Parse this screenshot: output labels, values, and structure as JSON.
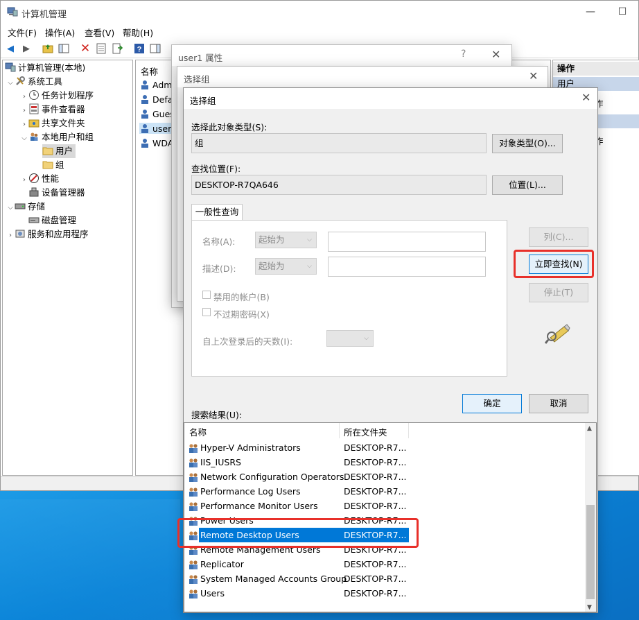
{
  "window": {
    "title": "计算机管理"
  },
  "menu": [
    "文件(F)",
    "操作(A)",
    "查看(V)",
    "帮助(H)"
  ],
  "tree": {
    "root": "计算机管理(本地)",
    "items": [
      {
        "label": "系统工具",
        "level": 1,
        "expanded": true
      },
      {
        "label": "任务计划程序",
        "level": 2,
        "expanded": false
      },
      {
        "label": "事件查看器",
        "level": 2,
        "expanded": false
      },
      {
        "label": "共享文件夹",
        "level": 2,
        "expanded": false
      },
      {
        "label": "本地用户和组",
        "level": 2,
        "expanded": true
      },
      {
        "label": "用户",
        "level": 3,
        "selected": true
      },
      {
        "label": "组",
        "level": 3
      },
      {
        "label": "性能",
        "level": 2,
        "expanded": false
      },
      {
        "label": "设备管理器",
        "level": 2
      },
      {
        "label": "存储",
        "level": 1,
        "expanded": true
      },
      {
        "label": "磁盘管理",
        "level": 2
      },
      {
        "label": "服务和应用程序",
        "level": 1,
        "expanded": false
      }
    ]
  },
  "list": {
    "header": "名称",
    "rows": [
      "Admi",
      "Defa",
      "Gues",
      "user1",
      "WDA"
    ]
  },
  "actions": {
    "header": "操作",
    "section1": "用户",
    "item1": "作",
    "item2": "作"
  },
  "back_dialog1": {
    "title": "user1 属性",
    "help": "?",
    "close": "✕"
  },
  "back_dialog2": {
    "title": "选择组",
    "close": "✕"
  },
  "dialog": {
    "title": "选择组",
    "close": "✕",
    "object_type_label": "选择此对象类型(S):",
    "object_type_value": "组",
    "object_type_button": "对象类型(O)...",
    "location_label": "查找位置(F):",
    "location_value": "DESKTOP-R7QA646",
    "location_button": "位置(L)...",
    "tab_label": "一般性查询",
    "name_label": "名称(A):",
    "name_combo": "起始为",
    "desc_label": "描述(D):",
    "desc_combo": "起始为",
    "disabled_accounts": "禁用的帐户(B)",
    "non_expiring": "不过期密码(X)",
    "days_label": "自上次登录后的天数(I):",
    "columns_button": "列(C)...",
    "find_now_button": "立即查找(N)",
    "stop_button": "停止(T)",
    "ok_button": "确定",
    "cancel_button": "取消",
    "results_label": "搜索结果(U):"
  },
  "results": {
    "col_name": "名称",
    "col_location": "所在文件夹",
    "rows": [
      {
        "name": "Hyper-V Administrators",
        "location": "DESKTOP-R7..."
      },
      {
        "name": "IIS_IUSRS",
        "location": "DESKTOP-R7..."
      },
      {
        "name": "Network Configuration Operators",
        "location": "DESKTOP-R7..."
      },
      {
        "name": "Performance Log Users",
        "location": "DESKTOP-R7..."
      },
      {
        "name": "Performance Monitor Users",
        "location": "DESKTOP-R7..."
      },
      {
        "name": "Power Users",
        "location": "DESKTOP-R7..."
      },
      {
        "name": "Remote Desktop Users",
        "location": "DESKTOP-R7...",
        "selected": true
      },
      {
        "name": "Remote Management Users",
        "location": "DESKTOP-R7..."
      },
      {
        "name": "Replicator",
        "location": "DESKTOP-R7..."
      },
      {
        "name": "System Managed Accounts Group",
        "location": "DESKTOP-R7..."
      },
      {
        "name": "Users",
        "location": "DESKTOP-R7..."
      }
    ]
  },
  "colors": {
    "highlight": "#0078d7",
    "annotation": "#e8302a"
  }
}
